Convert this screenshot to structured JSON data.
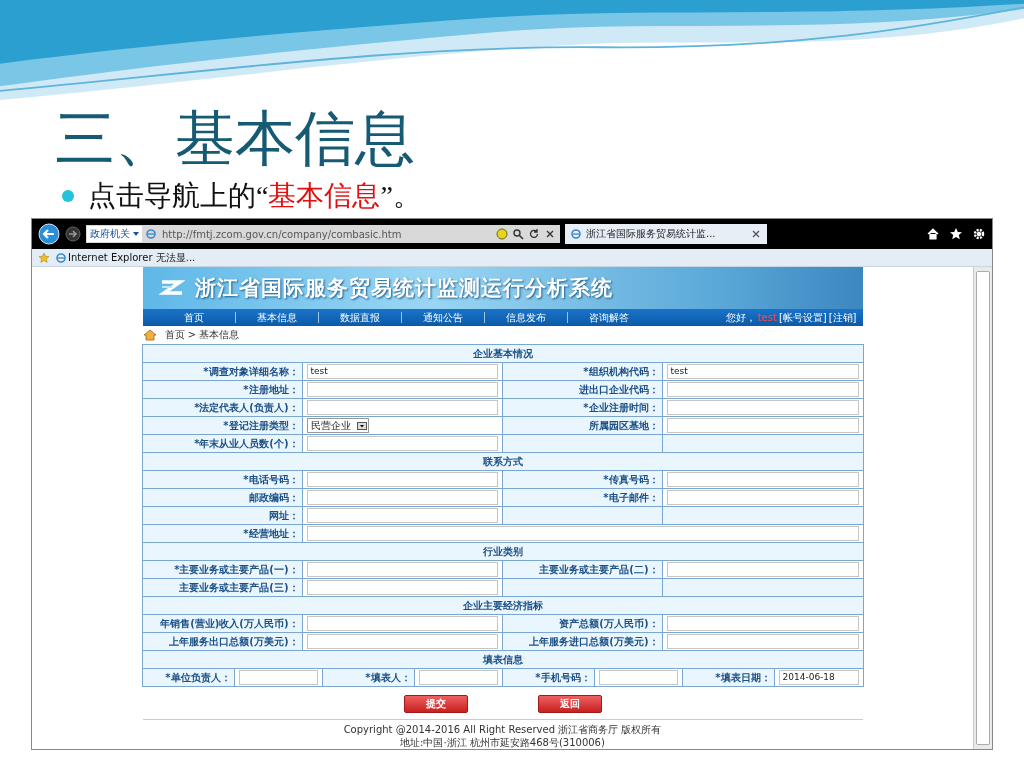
{
  "slide": {
    "title": "三、基本信息",
    "bullet": {
      "before": "点击导航上的“",
      "highlight": "基本信息",
      "after": "”。"
    }
  },
  "browser": {
    "address_scope": "政府机关",
    "url": "http://fmtj.zcom.gov.cn/company/combasic.htm",
    "tab": "浙江省国际服务贸易统计监...",
    "favorite": "Internet Explorer 无法显..."
  },
  "site": {
    "title": "浙江省国际服务贸易统计监测运行分析系统",
    "nav": [
      {
        "label": "首页"
      },
      {
        "label": "基本信息"
      },
      {
        "label": "数据直报"
      },
      {
        "label": "通知公告"
      },
      {
        "label": "信息发布"
      },
      {
        "label": "咨询解答"
      }
    ],
    "greeting": "您好，",
    "user": "test",
    "account_link": "[帐号设置]",
    "logout_link": "[注销]",
    "breadcrumb": "首页 > 基本信息"
  },
  "form": {
    "sections": [
      {
        "title": "企业基本情况",
        "rows": [
          [
            {
              "mark": "*",
              "label": "调查对象详细名称：",
              "kind": "text",
              "value": "test"
            },
            {
              "mark": "*",
              "label": "组织机构代码：",
              "kind": "text",
              "value": "test"
            }
          ],
          [
            {
              "mark": "*",
              "label": "注册地址：",
              "kind": "text"
            },
            {
              "label": "进出口企业代码：",
              "kind": "text"
            }
          ],
          [
            {
              "mark": "*",
              "label": "法定代表人(负责人)：",
              "kind": "text"
            },
            {
              "mark": "*",
              "label": "企业注册时间：",
              "kind": "text"
            }
          ],
          [
            {
              "mark": "*",
              "label": "登记注册类型：",
              "kind": "select",
              "value": "民营企业"
            },
            {
              "label": "所属园区基地：",
              "kind": "text"
            }
          ],
          [
            {
              "mark": "*",
              "label": "年末从业人员数(个)：",
              "kind": "text"
            }
          ]
        ]
      },
      {
        "title": "联系方式",
        "rows": [
          [
            {
              "mark": "*",
              "label": "电话号码：",
              "kind": "text"
            },
            {
              "mark": "*",
              "label": "传真号码：",
              "kind": "text"
            }
          ],
          [
            {
              "label": "邮政编码：",
              "kind": "text"
            },
            {
              "mark": "*",
              "label": "电子邮件：",
              "kind": "text"
            }
          ],
          [
            {
              "label": "网址：",
              "kind": "text"
            }
          ],
          [
            {
              "mark": "*",
              "label": "经营地址：",
              "kind": "wide"
            }
          ]
        ]
      },
      {
        "title": "行业类别",
        "rows": [
          [
            {
              "mark": "*",
              "label": "主要业务或主要产品(一)：",
              "kind": "text"
            },
            {
              "label": "主要业务或主要产品(二)：",
              "kind": "text"
            }
          ],
          [
            {
              "label": "主要业务或主要产品(三)：",
              "kind": "text"
            }
          ]
        ]
      },
      {
        "title": "企业主要经济指标",
        "rows": [
          [
            {
              "label": "年销售(营业)收入(万人民币)：",
              "kind": "text"
            },
            {
              "label": "资产总额(万人民币)：",
              "kind": "text"
            }
          ],
          [
            {
              "label": "上年服务出口总额(万美元)：",
              "kind": "text"
            },
            {
              "label": "上年服务进口总额(万美元)：",
              "kind": "text"
            }
          ]
        ]
      },
      {
        "title": "填表信息",
        "rows": [
          [
            {
              "mark": "*",
              "label": "单位负责人：",
              "kind": "text"
            },
            {
              "mark": "*",
              "label": "填表人：",
              "kind": "text"
            },
            {
              "mark": "*",
              "label": "手机号码：",
              "kind": "text"
            },
            {
              "mark": "*",
              "label": "填表日期：",
              "kind": "text",
              "value": "2014-06-18"
            }
          ]
        ]
      }
    ]
  },
  "buttons": [
    {
      "label": "提交"
    },
    {
      "label": "返回"
    }
  ],
  "footer": [
    "Copyright @2014-2016 All Right Reserved 浙江省商务厅 版权所有",
    "地址:中国·浙江 杭州市延安路468号(310006)"
  ]
}
